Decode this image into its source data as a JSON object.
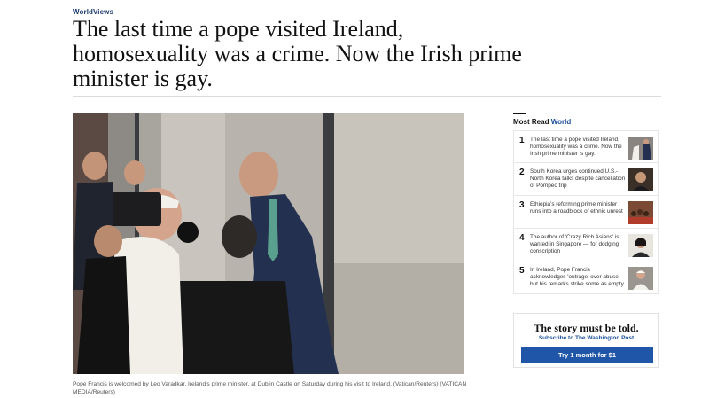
{
  "article": {
    "kicker": "WorldViews",
    "headline": "The last time a pope visited Ireland, homosexuality was a crime. Now the Irish prime minister is gay.",
    "caption": "Pope Francis is welcomed by Leo Varadkar, Ireland's prime minister, at Dublin Castle on Saturday during his visit to Ireland. (Vatican/Reuters) (VATICAN MEDIA/Reuters)"
  },
  "most_read": {
    "label": "Most Read",
    "section": "World",
    "items": [
      {
        "num": "1",
        "text": "The last time a pope visited Ireland, homosexuality was a crime. Now the Irish prime minister is gay.",
        "thumb_color": "#6f6a65"
      },
      {
        "num": "2",
        "text": "South Korea urges continued U.S.-North Korea talks despite cancellation of Pompeo trip",
        "thumb_color": "#3a3028"
      },
      {
        "num": "3",
        "text": "Ethiopia's reforming prime minister runs into a roadblock of ethnic unrest",
        "thumb_color": "#7a4a35"
      },
      {
        "num": "4",
        "text": "The author of 'Crazy Rich Asians' is wanted in Singapore — for dodging conscription",
        "thumb_color": "#5a4038"
      },
      {
        "num": "5",
        "text": "In Ireland, Pope Francis acknowledges 'outrage' over abuse, but his remarks strike some as empty",
        "thumb_color": "#8a8580"
      }
    ]
  },
  "promo": {
    "title": "The story must be told.",
    "subtitle": "Subscribe to The Washington Post",
    "button": "Try 1 month for $1"
  },
  "colors": {
    "accent": "#1a4f9a",
    "button": "#1f56a8",
    "kicker": "#1a3a6e"
  }
}
